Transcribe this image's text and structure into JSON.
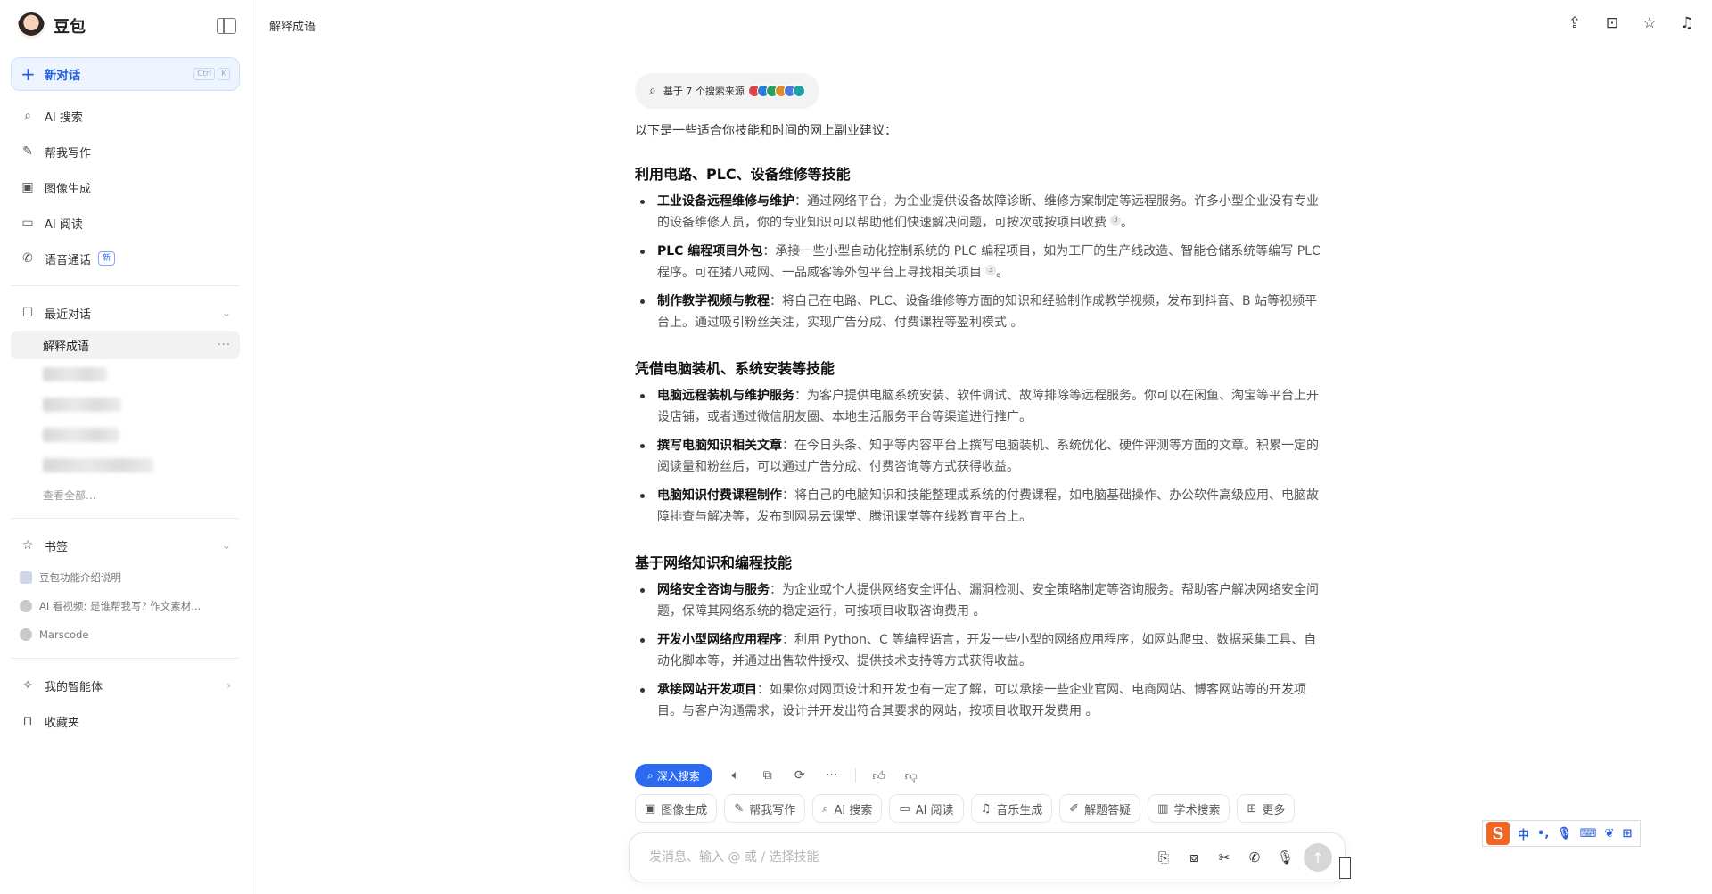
{
  "app": {
    "name": "豆包",
    "conversation_title": "解释成语"
  },
  "sidebar": {
    "new_chat": {
      "label": "新对话",
      "shortcut": [
        "Ctrl",
        "K"
      ]
    },
    "nav": [
      {
        "icon": "search-icon",
        "label": "AI 搜索"
      },
      {
        "icon": "pen-icon",
        "label": "帮我写作"
      },
      {
        "icon": "image-icon",
        "label": "图像生成"
      },
      {
        "icon": "book-icon",
        "label": "AI 阅读"
      },
      {
        "icon": "phone-icon",
        "label": "语音通话",
        "badge": "新"
      }
    ],
    "recent": {
      "label": "最近对话",
      "active_item": "解释成语",
      "see_all": "查看全部..."
    },
    "bookmarks": {
      "label": "书签",
      "items": [
        {
          "label": "豆包功能介绍说明"
        },
        {
          "label": "AI 看视频: 是谁帮我写? 作文素材..."
        },
        {
          "label": "Marscode"
        }
      ]
    },
    "agents_label": "我的智能体",
    "favorites_label": "收藏夹"
  },
  "content": {
    "source_pill": "基于 7 个搜索来源",
    "intro": "以下是一些适合你技能和时间的网上副业建议：",
    "sections": [
      {
        "heading": "利用电路、PLC、设备维修等技能",
        "items": [
          {
            "title": "工业设备远程维修与维护",
            "text": "：通过网络平台，为企业提供设备故障诊断、维修方案制定等远程服务。许多小型企业没有专业的设备维修人员，你的专业知识可以帮助他们快速解决问题，可按次或按项目收费",
            "cite": "3",
            "tail": "。"
          },
          {
            "title": "PLC 编程项目外包",
            "text": "：承接一些小型自动化控制系统的 PLC 编程项目，如为工厂的生产线改造、智能仓储系统等编写 PLC 程序。可在猪八戒网、一品威客等外包平台上寻找相关项目",
            "cite": "3",
            "tail": "。"
          },
          {
            "title": "制作教学视频与教程",
            "text": "：将自己在电路、PLC、设备维修等方面的知识和经验制作成教学视频，发布到抖音、B 站等视频平台上。通过吸引粉丝关注，实现广告分成、付费课程等盈利模式 。",
            "cite": "",
            "tail": ""
          }
        ]
      },
      {
        "heading": "凭借电脑装机、系统安装等技能",
        "items": [
          {
            "title": "电脑远程装机与维护服务",
            "text": "：为客户提供电脑系统安装、软件调试、故障排除等远程服务。你可以在闲鱼、淘宝等平台上开设店铺，或者通过微信朋友圈、本地生活服务平台等渠道进行推广。",
            "cite": "",
            "tail": ""
          },
          {
            "title": "撰写电脑知识相关文章",
            "text": "：在今日头条、知乎等内容平台上撰写电脑装机、系统优化、硬件评测等方面的文章。积累一定的阅读量和粉丝后，可以通过广告分成、付费咨询等方式获得收益。",
            "cite": "",
            "tail": ""
          },
          {
            "title": "电脑知识付费课程制作",
            "text": "：将自己的电脑知识和技能整理成系统的付费课程，如电脑基础操作、办公软件高级应用、电脑故障排查与解决等，发布到网易云课堂、腾讯课堂等在线教育平台上。",
            "cite": "",
            "tail": ""
          }
        ]
      },
      {
        "heading": "基于网络知识和编程技能",
        "items": [
          {
            "title": "网络安全咨询与服务",
            "text": "：为企业或个人提供网络安全评估、漏洞检测、安全策略制定等咨询服务。帮助客户解决网络安全问题，保障其网络系统的稳定运行，可按项目收取咨询费用 。",
            "cite": "",
            "tail": ""
          },
          {
            "title": "开发小型网络应用程序",
            "text": "：利用 Python、C 等编程语言，开发一些小型的网络应用程序，如网站爬虫、数据采集工具、自动化脚本等，并通过出售软件授权、提供技术支持等方式获得收益。",
            "cite": "",
            "tail": ""
          },
          {
            "title": "承接网站开发项目",
            "text": "：如果你对网页设计和开发也有一定了解，可以承接一些企业官网、电商网站、博客网站等的开发项目。与客户沟通需求，设计并开发出符合其要求的网站，按项目收取开发费用 。",
            "cite": "",
            "tail": ""
          }
        ]
      }
    ]
  },
  "actions": {
    "deep_search": "深入搜索"
  },
  "skills": [
    {
      "icon": "image-icon",
      "label": "图像生成"
    },
    {
      "icon": "pen-icon",
      "label": "帮我写作"
    },
    {
      "icon": "search-icon",
      "label": "AI 搜索"
    },
    {
      "icon": "book-icon",
      "label": "AI 阅读"
    },
    {
      "icon": "music-icon",
      "label": "音乐生成"
    },
    {
      "icon": "quiz-icon",
      "label": "解题答疑"
    },
    {
      "icon": "scholar-icon",
      "label": "学术搜索"
    },
    {
      "icon": "grid-icon",
      "label": "更多"
    }
  ],
  "input": {
    "placeholder": "发消息、输入 @ 或 / 选择技能"
  },
  "ime": {
    "logo": "S",
    "mode": "中"
  },
  "colors": {
    "accent": "#2b6bf1",
    "new_chat_bg": "#eef4ff"
  }
}
